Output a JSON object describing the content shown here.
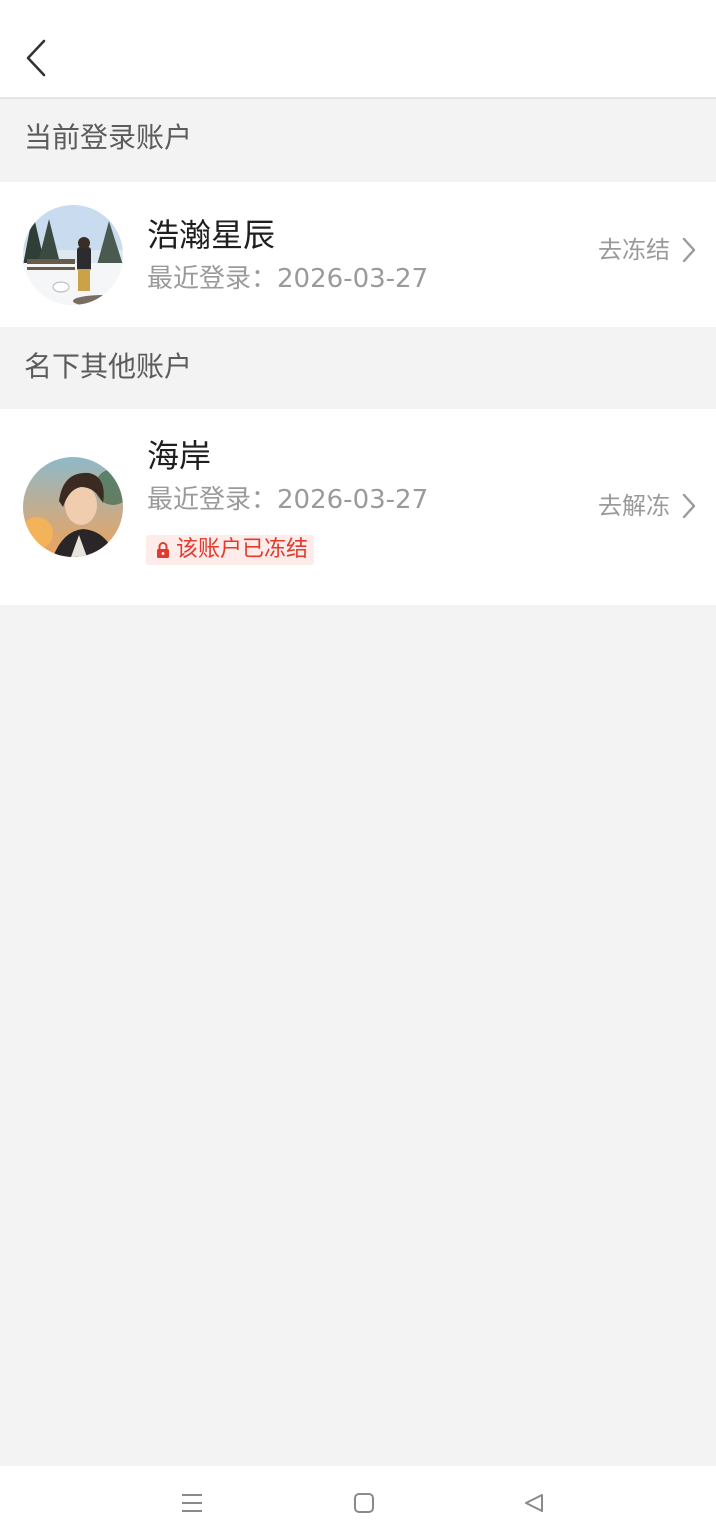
{
  "header": {
    "back_icon": "chevron-left-icon"
  },
  "current_section": {
    "title": "当前登录账户",
    "account": {
      "name": "浩瀚星辰",
      "login_label": "最近登录：",
      "login_date": "2026-03-27",
      "action_label": "去冻结",
      "avatar": "winter-scene-avatar"
    }
  },
  "other_section": {
    "title": "名下其他账户",
    "account": {
      "name": "海岸",
      "login_label": "最近登录：",
      "login_date": "2026-03-27",
      "status_text": "该账户已冻结",
      "status_icon": "lock-icon",
      "action_label": "去解冻",
      "avatar": "anime-boy-avatar"
    }
  },
  "navbar": {
    "items": [
      "menu-icon",
      "home-square-icon",
      "back-triangle-icon"
    ]
  },
  "colors": {
    "background": "#f3f3f3",
    "card": "#ffffff",
    "frozen_text": "#e23a2c",
    "frozen_bg": "#fdecea",
    "secondary_text": "#9a9a9a"
  }
}
